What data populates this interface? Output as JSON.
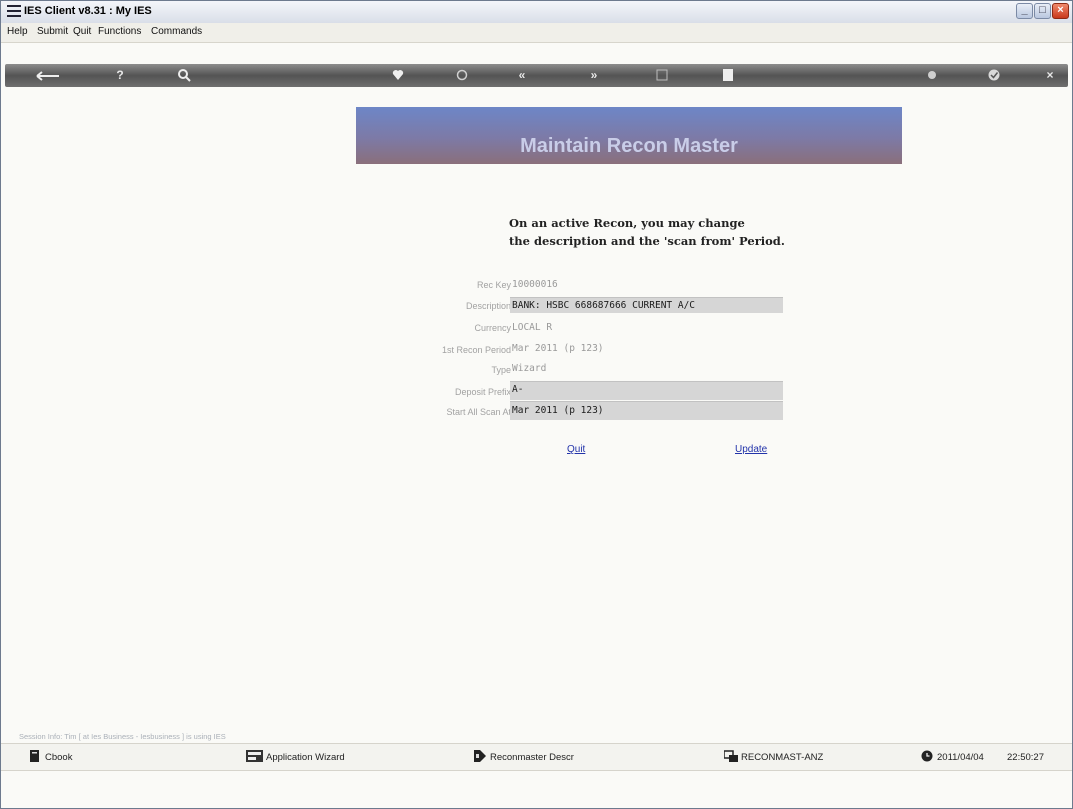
{
  "window": {
    "title": "IES Client v8.31 : My IES"
  },
  "menu": [
    "Help",
    "Submit",
    "Quit",
    "Functions",
    "Commands"
  ],
  "toolbar": {
    "help_symbol": "?",
    "prev_symbol": "«",
    "next_symbol": "»",
    "cancel_symbol": "×"
  },
  "banner": {
    "title": "Maintain Recon Master"
  },
  "intro": {
    "line1": "On an active Recon, you may change",
    "line2": "the description and the 'scan from' Period."
  },
  "form": {
    "rec_key": {
      "label": "Rec Key",
      "value": "10000016"
    },
    "description": {
      "label": "Description",
      "value": "BANK: HSBC 668687666 CURRENT A/C"
    },
    "currency": {
      "label": "Currency",
      "value": "LOCAL R"
    },
    "first_recon_period": {
      "label": "1st Recon Period",
      "value": "Mar 2011 (p 123)"
    },
    "type": {
      "label": "Type",
      "value": "Wizard"
    },
    "deposit_prefix": {
      "label": "Deposit Prefix",
      "value": "A-"
    },
    "start_all_scan_at": {
      "label": "Start All Scan At",
      "value": "Mar 2011 (p 123)"
    }
  },
  "actions": {
    "quit": "Quit",
    "update": "Update"
  },
  "session_info": "Session Info: Tim [ at Ies Business - Iesbusiness ] is using IES",
  "status": {
    "cbook": "Cbook",
    "app_wizard": "Application Wizard",
    "recon_descr": "Reconmaster Descr",
    "program": "RECONMAST-ANZ",
    "date": "2011/04/04",
    "time": "22:50:27"
  }
}
